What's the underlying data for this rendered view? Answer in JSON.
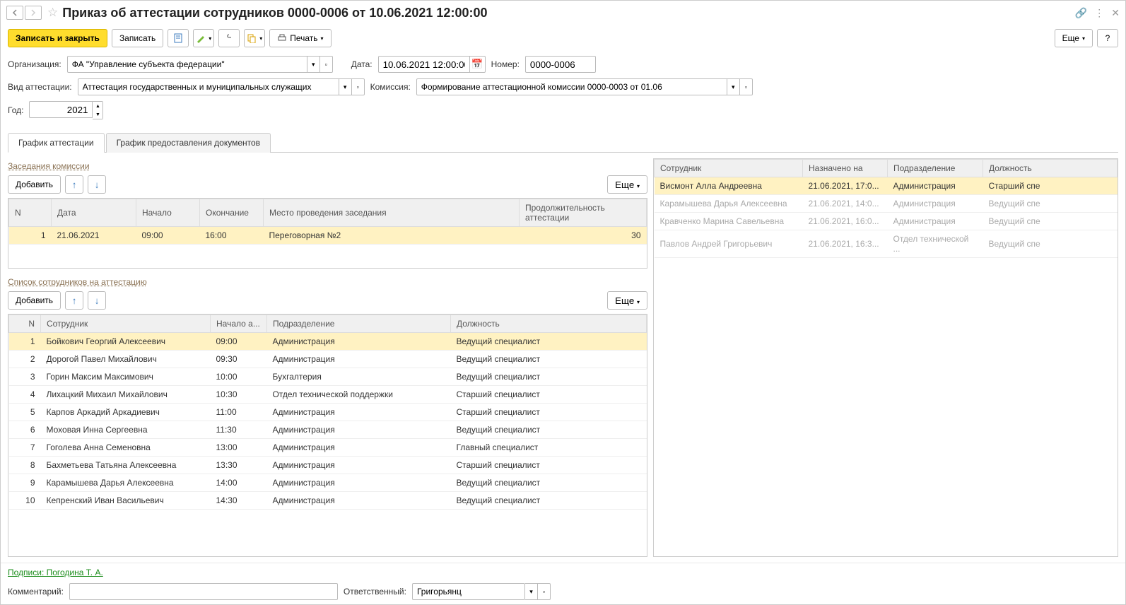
{
  "title": "Приказ об аттестации сотрудников 0000-0006 от 10.06.2021 12:00:00",
  "toolbar": {
    "save_close": "Записать и закрыть",
    "save": "Записать",
    "print": "Печать",
    "more": "Еще"
  },
  "form": {
    "org_label": "Организация:",
    "org_value": "ФА \"Управление субъекта федерации\"",
    "date_label": "Дата:",
    "date_value": "10.06.2021 12:00:00",
    "number_label": "Номер:",
    "number_value": "0000-0006",
    "att_type_label": "Вид аттестации:",
    "att_type_value": "Аттестация государственных и муниципальных служащих",
    "commission_label": "Комиссия:",
    "commission_value": "Формирование аттестационной комиссии 0000-0003 от 01.06",
    "year_label": "Год:",
    "year_value": "2021"
  },
  "tabs": {
    "schedule": "График аттестации",
    "docs": "График предоставления документов"
  },
  "meetings": {
    "title": "Заседания комиссии",
    "add": "Добавить",
    "more": "Еще",
    "columns": {
      "n": "N",
      "date": "Дата",
      "start": "Начало",
      "end": "Окончание",
      "place": "Место проведения заседания",
      "duration": "Продолжительность аттестации"
    },
    "rows": [
      {
        "n": "1",
        "date": "21.06.2021",
        "start": "09:00",
        "end": "16:00",
        "place": "Переговорная №2",
        "duration": "30"
      }
    ]
  },
  "employees_list": {
    "title": "Список сотрудников на аттестацию",
    "add": "Добавить",
    "more": "Еще",
    "columns": {
      "n": "N",
      "employee": "Сотрудник",
      "start": "Начало а...",
      "dept": "Подразделение",
      "position": "Должность"
    },
    "rows": [
      {
        "n": "1",
        "employee": "Бойкович Георгий Алексеевич",
        "start": "09:00",
        "dept": "Администрация",
        "position": "Ведущий специалист"
      },
      {
        "n": "2",
        "employee": "Дорогой Павел Михайлович",
        "start": "09:30",
        "dept": "Администрация",
        "position": "Ведущий специалист"
      },
      {
        "n": "3",
        "employee": "Горин Максим Максимович",
        "start": "10:00",
        "dept": "Бухгалтерия",
        "position": "Ведущий специалист"
      },
      {
        "n": "4",
        "employee": "Лихацкий Михаил Михайлович",
        "start": "10:30",
        "dept": "Отдел технической поддержки",
        "position": "Старший специалист"
      },
      {
        "n": "5",
        "employee": "Карпов Аркадий Аркадиевич",
        "start": "11:00",
        "dept": "Администрация",
        "position": "Старший специалист"
      },
      {
        "n": "6",
        "employee": "Моховая Инна Сергеевна",
        "start": "11:30",
        "dept": "Администрация",
        "position": "Ведущий специалист"
      },
      {
        "n": "7",
        "employee": "Гоголева Анна Семеновна",
        "start": "13:00",
        "dept": "Администрация",
        "position": "Главный специалист"
      },
      {
        "n": "8",
        "employee": "Бахметьева Татьяна Алексеевна",
        "start": "13:30",
        "dept": "Администрация",
        "position": "Старший специалист"
      },
      {
        "n": "9",
        "employee": "Карамышева Дарья Алексеевна",
        "start": "14:00",
        "dept": "Администрация",
        "position": "Ведущий специалист"
      },
      {
        "n": "10",
        "employee": "Кепренский Иван Васильевич",
        "start": "14:30",
        "dept": "Администрация",
        "position": "Ведущий специалист"
      }
    ]
  },
  "right_table": {
    "columns": {
      "employee": "Сотрудник",
      "assigned": "Назначено на",
      "dept": "Подразделение",
      "position": "Должность"
    },
    "rows": [
      {
        "employee": "Висмонт Алла Андреевна",
        "assigned": "21.06.2021, 17:0...",
        "dept": "Администрация",
        "position": "Старший спе",
        "selected": true
      },
      {
        "employee": "Карамышева Дарья Алексеевна",
        "assigned": "21.06.2021, 14:0...",
        "dept": "Администрация",
        "position": "Ведущий спе"
      },
      {
        "employee": "Кравченко Марина Савельевна",
        "assigned": "21.06.2021, 16:0...",
        "dept": "Администрация",
        "position": "Ведущий спе"
      },
      {
        "employee": "Павлов Андрей Григорьевич",
        "assigned": "21.06.2021, 16:3...",
        "dept": "Отдел технической ...",
        "position": "Ведущий спе"
      }
    ]
  },
  "footer": {
    "signatures": "Подписи: Погодина Т. А.",
    "comment_label": "Комментарий:",
    "comment_value": "",
    "responsible_label": "Ответственный:",
    "responsible_value": "Григорьянц"
  }
}
